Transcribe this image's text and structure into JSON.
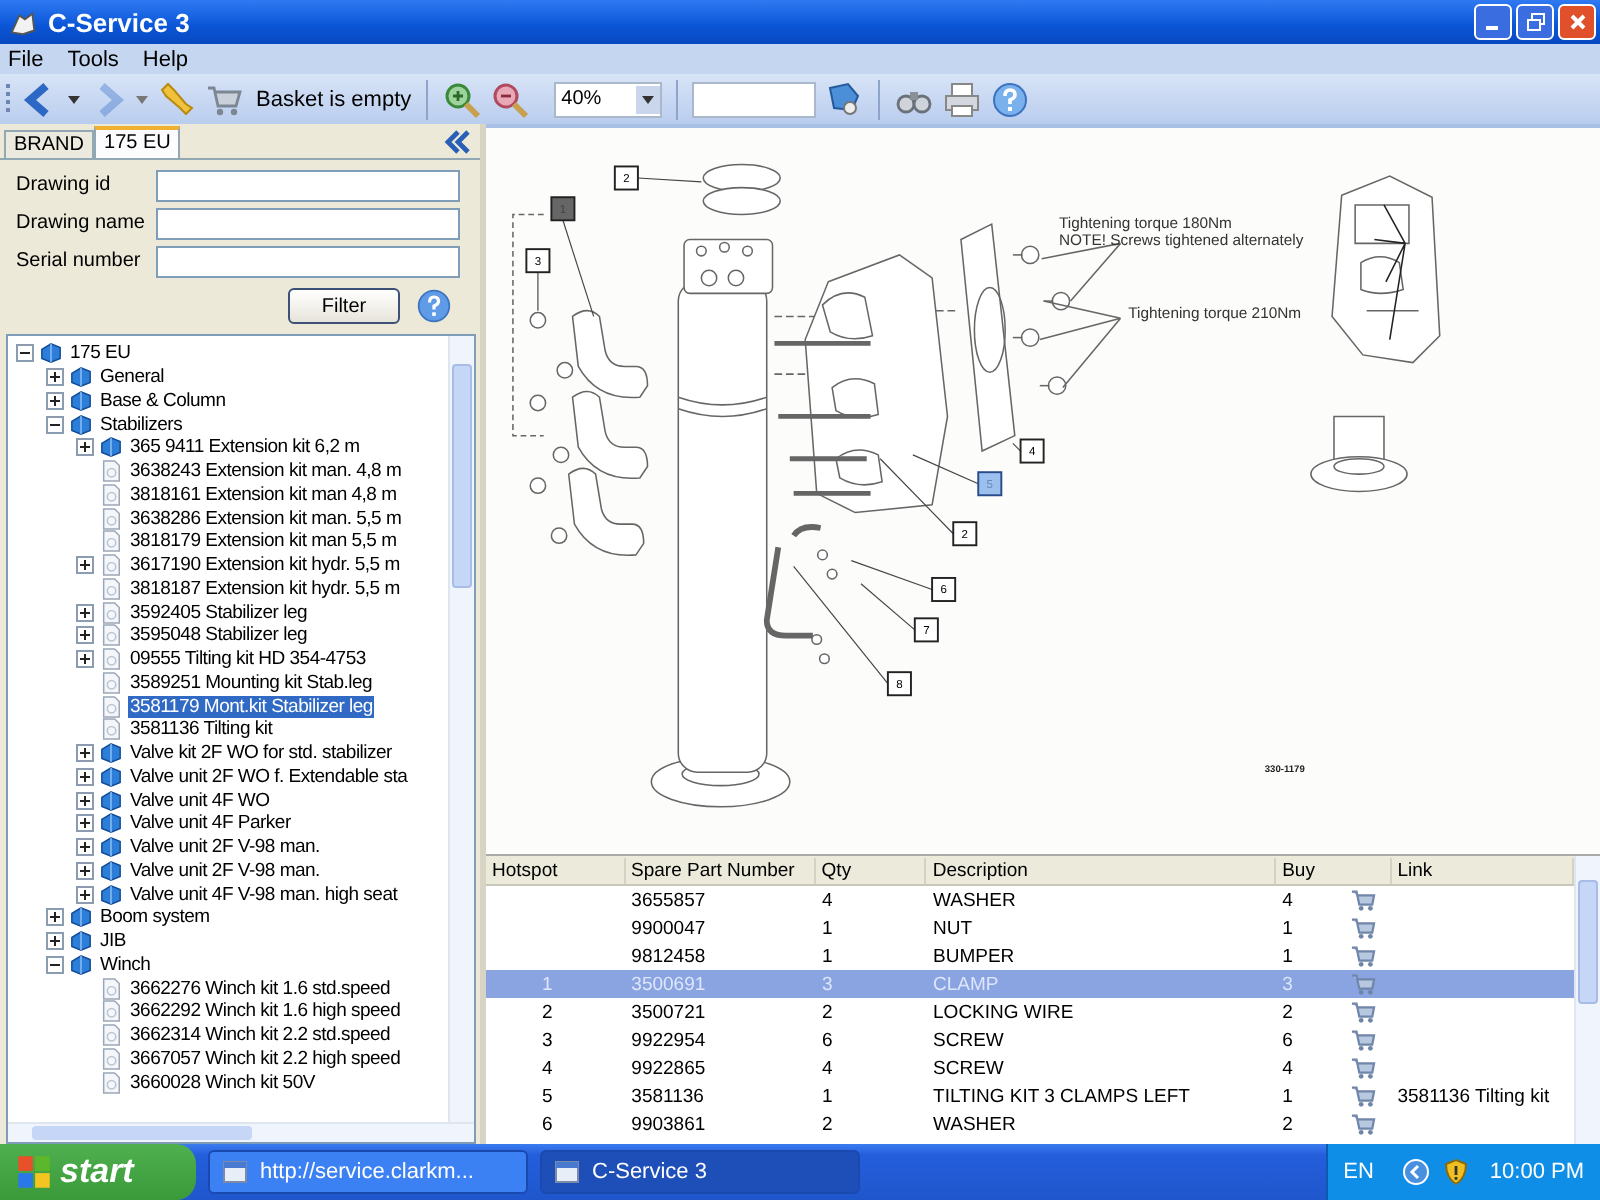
{
  "window": {
    "title": "C-Service 3"
  },
  "menu": [
    "File",
    "Tools",
    "Help"
  ],
  "toolbar": {
    "back_enabled": true,
    "forward_enabled": false,
    "basket_label": "Basket is empty",
    "zoom_value": "40%"
  },
  "left_panel": {
    "tabs": [
      {
        "label": "BRAND",
        "selected": false
      },
      {
        "label": "175 EU",
        "selected": true
      }
    ],
    "filter_fields": [
      {
        "label": "Drawing id"
      },
      {
        "label": "Drawing name"
      },
      {
        "label": "Serial number"
      }
    ],
    "filter_button": "Filter",
    "tree": [
      {
        "label": "175 EU",
        "kind": "book",
        "expanded": true,
        "selected": false,
        "children": [
          {
            "label": "General",
            "kind": "book",
            "expanded": false,
            "selected": false
          },
          {
            "label": "Base & Column",
            "kind": "book",
            "expanded": false,
            "selected": false
          },
          {
            "label": "Stabilizers",
            "kind": "book",
            "expanded": true,
            "selected": false,
            "children": [
              {
                "label": "365 9411 Extension kit 6,2 m",
                "kind": "book",
                "expanded": false,
                "selected": false
              },
              {
                "label": "3638243 Extension kit man. 4,8 m",
                "kind": "page",
                "selected": false
              },
              {
                "label": "3818161 Extension kit man 4,8 m",
                "kind": "page",
                "selected": false
              },
              {
                "label": "3638286 Extension kit man. 5,5 m",
                "kind": "page",
                "selected": false
              },
              {
                "label": "3818179 Extension kit man 5,5 m",
                "kind": "page",
                "selected": false
              },
              {
                "label": "3617190 Extension kit hydr. 5,5 m",
                "kind": "page",
                "expanded": false,
                "selected": false
              },
              {
                "label": "3818187 Extension kit hydr. 5,5 m",
                "kind": "page",
                "selected": false
              },
              {
                "label": "3592405 Stabilizer leg",
                "kind": "page",
                "expanded": false,
                "selected": false
              },
              {
                "label": "3595048 Stabilizer leg",
                "kind": "page",
                "expanded": false,
                "selected": false
              },
              {
                "label": "09555 Tilting kit HD 354-4753",
                "kind": "page",
                "expanded": false,
                "selected": false
              },
              {
                "label": "3589251 Mounting kit Stab.leg",
                "kind": "page",
                "selected": false
              },
              {
                "label": "3581179 Mont.kit Stabilizer leg",
                "kind": "page",
                "selected": true
              },
              {
                "label": "3581136 Tilting kit",
                "kind": "page",
                "selected": false
              },
              {
                "label": "Valve kit 2F WO for std. stabilizer",
                "kind": "book",
                "expanded": false,
                "selected": false
              },
              {
                "label": "Valve unit 2F WO f. Extendable sta",
                "kind": "book",
                "expanded": false,
                "selected": false
              },
              {
                "label": "Valve unit 4F WO",
                "kind": "book",
                "expanded": false,
                "selected": false
              },
              {
                "label": "Valve unit 4F Parker",
                "kind": "book",
                "expanded": false,
                "selected": false
              },
              {
                "label": "Valve unit 2F V-98 man.",
                "kind": "book",
                "expanded": false,
                "selected": false
              },
              {
                "label": "Valve unit 2F V-98 man.",
                "kind": "book",
                "expanded": false,
                "selected": false
              },
              {
                "label": "Valve unit 4F V-98 man. high seat",
                "kind": "book",
                "expanded": false,
                "selected": false
              }
            ]
          },
          {
            "label": "Boom system",
            "kind": "book",
            "expanded": false,
            "selected": false
          },
          {
            "label": "JIB",
            "kind": "book",
            "expanded": false,
            "selected": false
          },
          {
            "label": "Winch",
            "kind": "book",
            "expanded": true,
            "selected": false,
            "children": [
              {
                "label": "3662276 Winch kit 1.6 std.speed",
                "kind": "page",
                "selected": false
              },
              {
                "label": "3662292 Winch kit 1.6 high speed",
                "kind": "page",
                "selected": false
              },
              {
                "label": "3662314 Winch kit 2.2 std.speed",
                "kind": "page",
                "selected": false
              },
              {
                "label": "3667057 Winch kit 2.2 high speed",
                "kind": "page",
                "selected": false
              },
              {
                "label": "3660028 Winch kit 50V",
                "kind": "page",
                "selected": false
              }
            ]
          }
        ]
      }
    ]
  },
  "drawing": {
    "hotspots": [
      {
        "label": "2",
        "selected": false,
        "highlighted": false
      },
      {
        "label": "1",
        "selected": true,
        "highlighted": false
      },
      {
        "label": "3",
        "selected": false,
        "highlighted": false
      },
      {
        "label": "4",
        "selected": false,
        "highlighted": false
      },
      {
        "label": "5",
        "selected": false,
        "highlighted": true
      },
      {
        "label": "2",
        "selected": false,
        "highlighted": false
      },
      {
        "label": "6",
        "selected": false,
        "highlighted": false
      },
      {
        "label": "7",
        "selected": false,
        "highlighted": false
      },
      {
        "label": "8",
        "selected": false,
        "highlighted": false
      }
    ],
    "notes": [
      "Tightening torque 180Nm",
      "NOTE! Screws tightened alternately",
      "Tightening torque 210Nm"
    ],
    "drawing_number": "330-1179"
  },
  "parts_table": {
    "columns": [
      "Hotspot",
      "Spare Part Number",
      "Qty",
      "Description",
      "Buy",
      "Link"
    ],
    "rows": [
      {
        "part_number": "3655857",
        "qty": "4",
        "description": "WASHER",
        "buy": "4",
        "selected": false
      },
      {
        "part_number": "9900047",
        "qty": "1",
        "description": "NUT",
        "buy": "1",
        "selected": false
      },
      {
        "part_number": "9812458",
        "qty": "1",
        "description": "BUMPER",
        "buy": "1",
        "selected": false
      },
      {
        "hotspot": "1",
        "part_number": "3500691",
        "qty": "3",
        "description": "CLAMP",
        "buy": "3",
        "selected": true
      },
      {
        "hotspot": "2",
        "part_number": "3500721",
        "qty": "2",
        "description": "LOCKING WIRE",
        "buy": "2",
        "selected": false
      },
      {
        "hotspot": "3",
        "part_number": "9922954",
        "qty": "6",
        "description": "SCREW",
        "buy": "6",
        "selected": false
      },
      {
        "hotspot": "4",
        "part_number": "9922865",
        "qty": "4",
        "description": "SCREW",
        "buy": "4",
        "selected": false
      },
      {
        "hotspot": "5",
        "part_number": "3581136",
        "qty": "1",
        "description": "TILTING KIT 3 CLAMPS LEFT",
        "buy": "1",
        "link": "3581136 Tilting kit",
        "selected": false
      },
      {
        "hotspot": "6",
        "part_number": "9903861",
        "qty": "2",
        "description": "WASHER",
        "buy": "2",
        "selected": false
      }
    ]
  },
  "taskbar": {
    "start": "start",
    "tasks": [
      {
        "label": "http://service.clarkm...",
        "active": false
      },
      {
        "label": "C-Service 3",
        "active": true
      }
    ],
    "language": "EN",
    "clock": "10:00 PM"
  }
}
